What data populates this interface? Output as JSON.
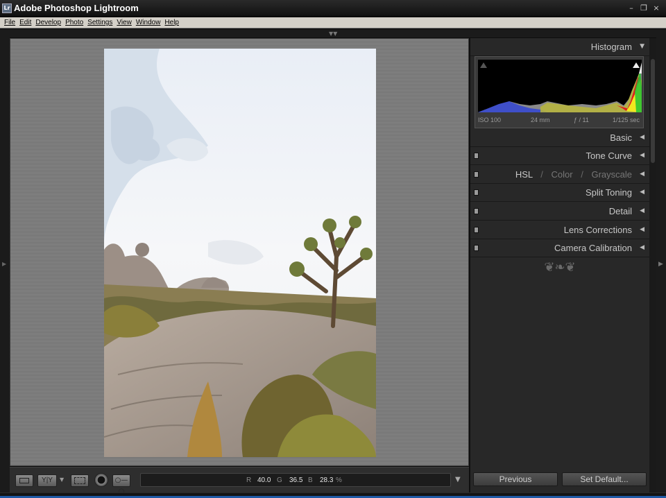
{
  "window": {
    "title": "Adobe Photoshop Lightroom",
    "icon_text": "Lr",
    "controls": [
      "minimize-icon",
      "restore-icon",
      "close-icon"
    ]
  },
  "menu": {
    "items": [
      "File",
      "Edit",
      "Develop",
      "Photo",
      "Settings",
      "View",
      "Window",
      "Help"
    ]
  },
  "histogram": {
    "title": "Histogram",
    "iso": "ISO 100",
    "focal": "24 mm",
    "aperture": "ƒ / 11",
    "shutter": "1/125 sec"
  },
  "panels": {
    "basic": "Basic",
    "tone_curve": "Tone Curve",
    "hsl": "HSL",
    "color": "Color",
    "grayscale": "Grayscale",
    "split_toning": "Split Toning",
    "detail": "Detail",
    "lens_corrections": "Lens Corrections",
    "camera_calibration": "Camera Calibration",
    "slash": "/"
  },
  "footer": {
    "previous": "Previous",
    "set_default": "Set Default..."
  },
  "readout": {
    "r_label": "R",
    "r_value": "40.0",
    "g_label": "G",
    "g_value": "36.5",
    "b_label": "B",
    "b_value": "28.3",
    "unit": "%"
  },
  "toolbar": {
    "compare_label": "Y|Y"
  },
  "colors": {
    "panel_bg": "#282828",
    "workspace_stripe": "#888888",
    "accent_blue": "#1f5aa6"
  }
}
